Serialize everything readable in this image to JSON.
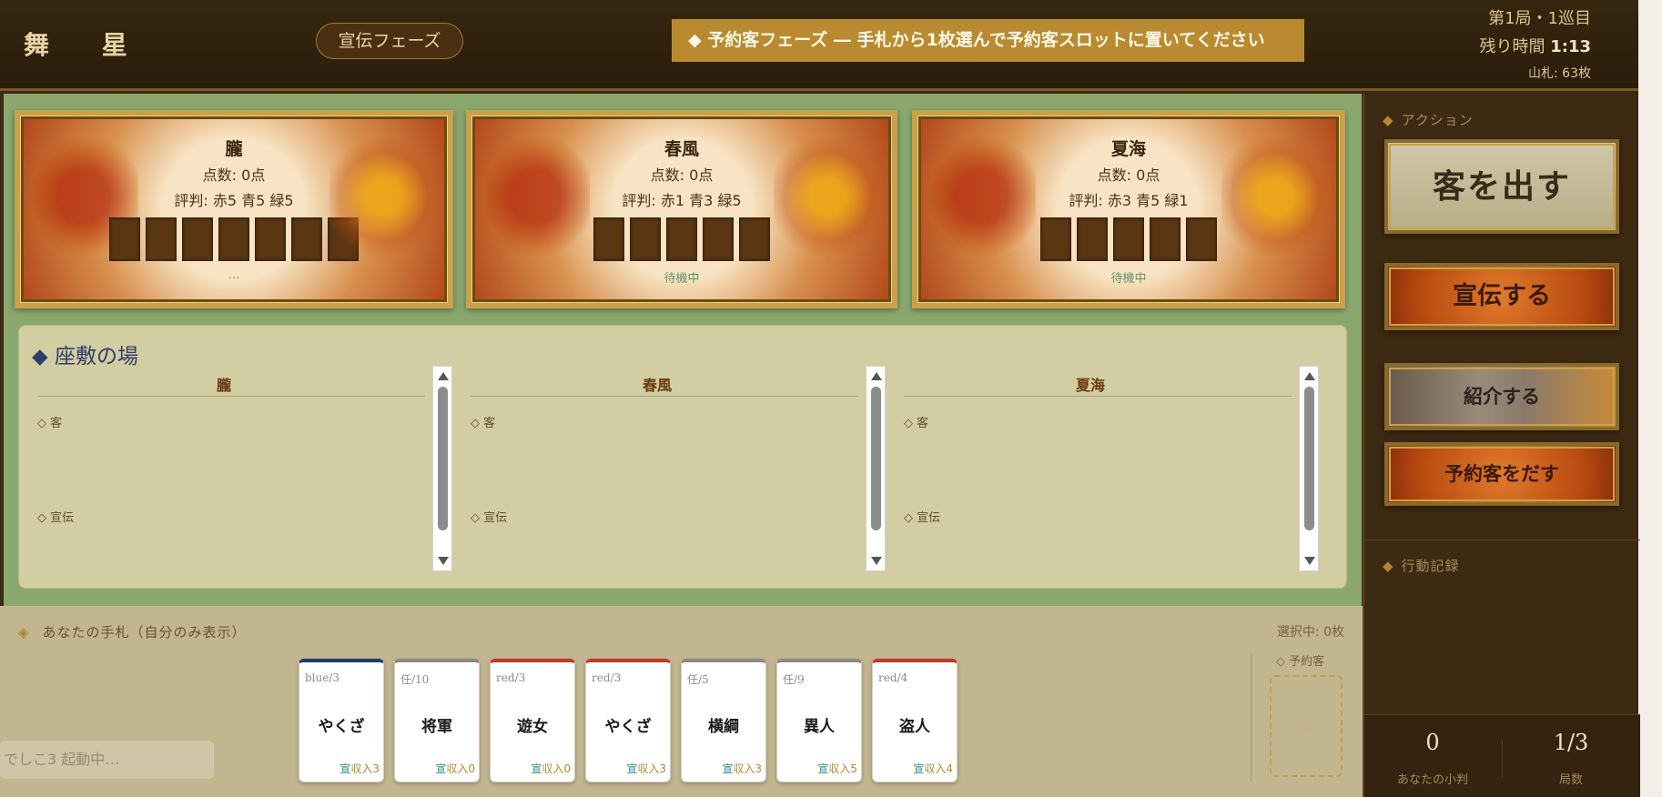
{
  "app": {
    "logo": "舞 星"
  },
  "header": {
    "phase_pill": "宣伝フェーズ",
    "banner": "◆ 予約客フェーズ ― 手札から1枚選んで予約客スロットに置いてください",
    "round": "第1局・1巡目",
    "time_label": "残り時間",
    "time_value": "1:13",
    "deck": "山札: 63枚"
  },
  "houses": [
    {
      "name": "朧",
      "points": "点数: 0点",
      "reputation": "評判: 赤5 青5 緑5",
      "status": "…"
    },
    {
      "name": "春風",
      "points": "点数: 0点",
      "reputation": "評判: 赤1 青3 緑5",
      "status": "待機中"
    },
    {
      "name": "夏海",
      "points": "点数: 0点",
      "reputation": "評判: 赤3 青5 緑1",
      "status": "待機中"
    }
  ],
  "zashiki": {
    "title": "◆ 座敷の場",
    "rooms": [
      {
        "name": "朧",
        "guest_label": "◇ 客",
        "promo_label": "◇ 宣伝"
      },
      {
        "name": "春風",
        "guest_label": "◇ 客",
        "promo_label": "◇ 宣伝"
      },
      {
        "name": "夏海",
        "guest_label": "◇ 客",
        "promo_label": "◇ 宣伝"
      }
    ]
  },
  "hand": {
    "title": "あなたの手札（自分のみ表示）",
    "diamond": "◈",
    "selected": "選択中: 0枚",
    "cards": [
      {
        "tag": "blue/3",
        "name": "やくざ",
        "promo": "宣",
        "income": "収入3",
        "color": "blue"
      },
      {
        "tag": "任/10",
        "name": "将軍",
        "promo": "宣",
        "income": "収入0",
        "color": "wild"
      },
      {
        "tag": "red/3",
        "name": "遊女",
        "promo": "宣",
        "income": "収入0",
        "color": "red"
      },
      {
        "tag": "red/3",
        "name": "やくざ",
        "promo": "宣",
        "income": "収入3",
        "color": "red"
      },
      {
        "tag": "任/5",
        "name": "横綱",
        "promo": "宣",
        "income": "収入3",
        "color": "wild"
      },
      {
        "tag": "任/9",
        "name": "異人",
        "promo": "宣",
        "income": "収入5",
        "color": "wild"
      },
      {
        "tag": "red/4",
        "name": "盗人",
        "promo": "宣",
        "income": "収入4",
        "color": "red"
      }
    ],
    "reserve_label": "◇ 予約客",
    "reserve_empty": "空",
    "toast": "でしこ3 起動中…"
  },
  "actions": {
    "header": "アクション",
    "dispatch": "客を出す",
    "promote": "宣伝する",
    "introduce": "紹介する",
    "reserve": "予約客をだす",
    "log_header": "行動記録"
  },
  "stats": {
    "coins_value": "0",
    "coins_label": "あなたの小判",
    "rounds_value": "1/3",
    "rounds_label": "局数"
  },
  "colors": {
    "banner": "#b98a2f",
    "field": "#8aa86e",
    "panel": "#3d2a13",
    "card_blue": "#1f3c6a",
    "card_red": "#c03a2a",
    "card_wild": "#8a8a8a"
  }
}
